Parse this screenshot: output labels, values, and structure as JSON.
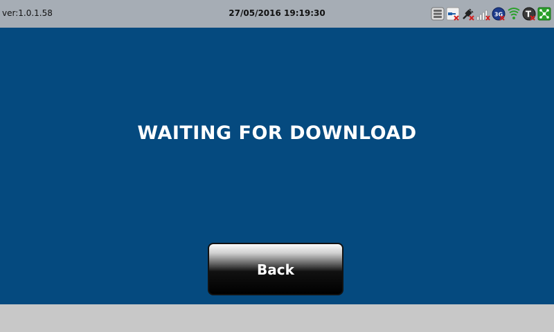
{
  "status_bar": {
    "version": "ver:1.0.1.58",
    "datetime": "27/05/2016 19:19:30",
    "icons": [
      "database-icon",
      "usb-disconnected-icon",
      "power-plug-disconnected-icon",
      "signal-strength-none-icon",
      "3g-disconnected-icon",
      "wifi-icon",
      "t-disconnected-icon",
      "network-icon"
    ]
  },
  "main": {
    "message": "WAITING FOR DOWNLOAD",
    "back_label": "Back"
  },
  "colors": {
    "status_bar_bg": "#a6adb5",
    "main_bg": "#054a7f",
    "footer_bg": "#c8c8c8",
    "text_white": "#ffffff",
    "error_red": "#d21f1f",
    "accent_green": "#2aa02a"
  }
}
